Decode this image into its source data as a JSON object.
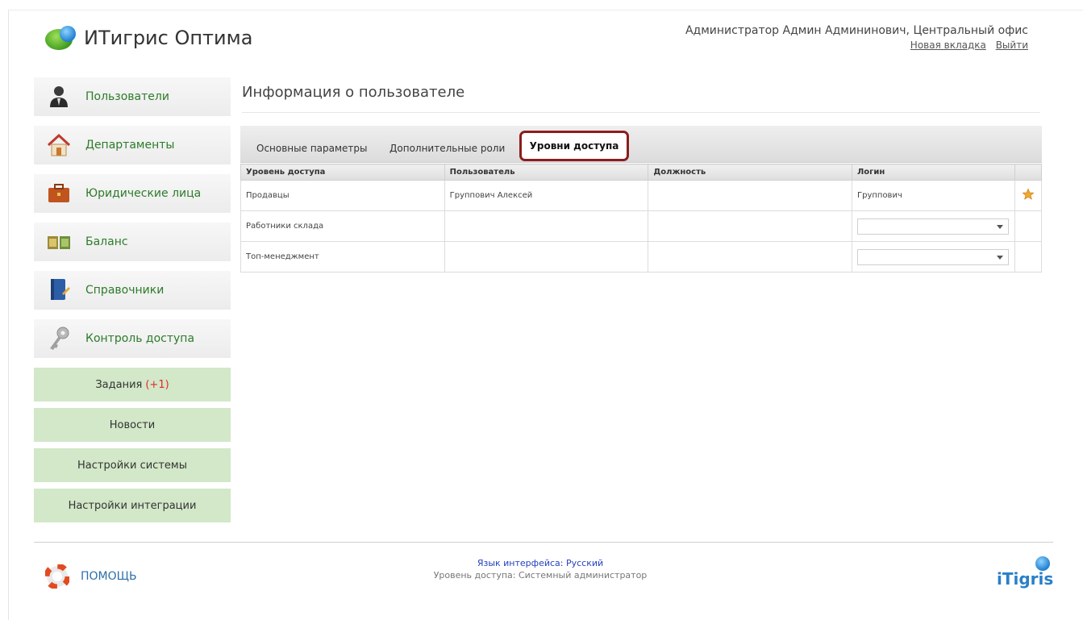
{
  "app": {
    "title": "ИТигрис Оптима",
    "user_name": "Администратор Админ Админинович, Центральный офис",
    "new_tab_link": "Новая вкладка",
    "logout_link": "Выйти"
  },
  "sidebar": {
    "items": [
      {
        "label": "Пользователи",
        "icon": "user-icon"
      },
      {
        "label": "Департаменты",
        "icon": "house-icon"
      },
      {
        "label": "Юридические лица",
        "icon": "briefcase-icon"
      },
      {
        "label": "Баланс",
        "icon": "balance-icon"
      },
      {
        "label": "Справочники",
        "icon": "book-icon"
      },
      {
        "label": "Контроль доступа",
        "icon": "key-icon"
      }
    ],
    "buttons": {
      "tasks_label": "Задания",
      "tasks_badge": "(+1)",
      "news_label": "Новости",
      "system_settings_label": "Настройки системы",
      "integration_settings_label": "Настройки интеграции"
    }
  },
  "main": {
    "page_title": "Информация о пользователе",
    "tabs": [
      {
        "label": "Основные параметры"
      },
      {
        "label": "Дополнительные роли"
      },
      {
        "label": "Уровни доступа",
        "active": true
      }
    ],
    "table": {
      "headers": [
        "Уровень доступа",
        "Пользователь",
        "Должность",
        "Логин"
      ],
      "rows": [
        {
          "level": "Продавцы",
          "user": "Группович Алексей",
          "position": "",
          "login": "Группович",
          "starred": true
        },
        {
          "level": "Работники склада",
          "user": "",
          "position": "",
          "login_select": ""
        },
        {
          "level": "Топ-менеджмент",
          "user": "",
          "position": "",
          "login_select": ""
        }
      ]
    }
  },
  "footer": {
    "help_label": "ПОМОЩЬ",
    "language": "Язык интерфейса: Русский",
    "access_level": "Уровень доступа: Системный администратор",
    "brand": "iTigris"
  },
  "colors": {
    "nav_text": "#2d7b2a",
    "green_button_bg": "#d2e8c8",
    "active_tab_border": "#8b1d1d",
    "badge": "#e22a2a"
  }
}
